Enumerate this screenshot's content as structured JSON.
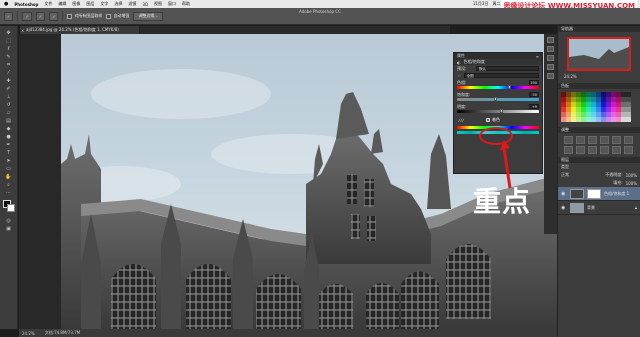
{
  "menubar": {
    "apple": "",
    "app": "Photoshop",
    "items": [
      "文件",
      "编辑",
      "图像",
      "图层",
      "文字",
      "选择",
      "滤镜",
      "3D",
      "视图",
      "窗口",
      "帮助"
    ],
    "right": [
      "11月3日",
      "周二",
      "22:16"
    ]
  },
  "watermark": "思缘设计论坛 WWW.MISSYUAN.COM",
  "window_title": "Adobe Photoshop CC",
  "options_bar": {
    "buttons": [
      "✓",
      "✓",
      "✓",
      "✓",
      "✓"
    ],
    "sample_all": "对所有图层取样",
    "auto_enhance": "自动增强",
    "refine": "调整边缘..."
  },
  "document": {
    "tab_title": "ajd13384.jpg @ 24.2% (色相/饱和度 1, CMYK/8)",
    "close": "×"
  },
  "status": {
    "zoom": "24.2%",
    "doc": "文档:74.8M/73.7M"
  },
  "properties": {
    "panel_title": "属性",
    "tab": "色相/饱和度",
    "preset_label": "预设:",
    "preset_value": "默认",
    "channel_value": "全图",
    "hue_label": "色相:",
    "hue_value": "190",
    "saturation_label": "饱和度:",
    "saturation_value": "50",
    "lightness_label": "明度:",
    "lightness_value": "+9",
    "colorize_label": "着色",
    "colorize_checked": "✓"
  },
  "annotation": "重点",
  "navigator": {
    "title": "导航器",
    "zoom": "24.2%"
  },
  "swatches_title": "色板",
  "adjustments_title": "调整",
  "layers": {
    "title": "图层",
    "kind": "类型",
    "blend": "正常",
    "opacity_label": "不透明度:",
    "opacity": "100%",
    "fill_label": "填充:",
    "fill": "100%",
    "items": [
      {
        "name": "色相/饱和度 1"
      },
      {
        "name": "背景"
      }
    ]
  },
  "colors": {
    "panel_bg": "#3c3c3c",
    "accent_red": "#e01818",
    "selection": "#5c6f8a"
  }
}
